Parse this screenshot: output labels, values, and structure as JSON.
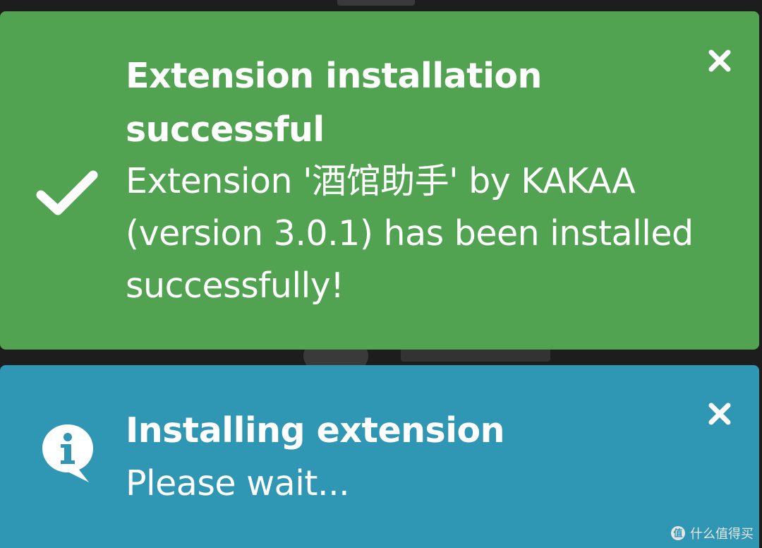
{
  "toasts": {
    "success": {
      "title": "Extension installation successful",
      "message": "Extension '酒馆助手' by KAKAA (version 3.0.1) has been installed successfully!",
      "icon": "checkmark-icon",
      "close_icon": "close-icon",
      "color": "#51a351"
    },
    "info": {
      "title": "Installing extension",
      "message": "Please wait...",
      "icon": "info-speech-bubble-icon",
      "close_icon": "close-icon",
      "color": "#2f96b4"
    }
  },
  "watermark": {
    "text": "什么值得买"
  }
}
